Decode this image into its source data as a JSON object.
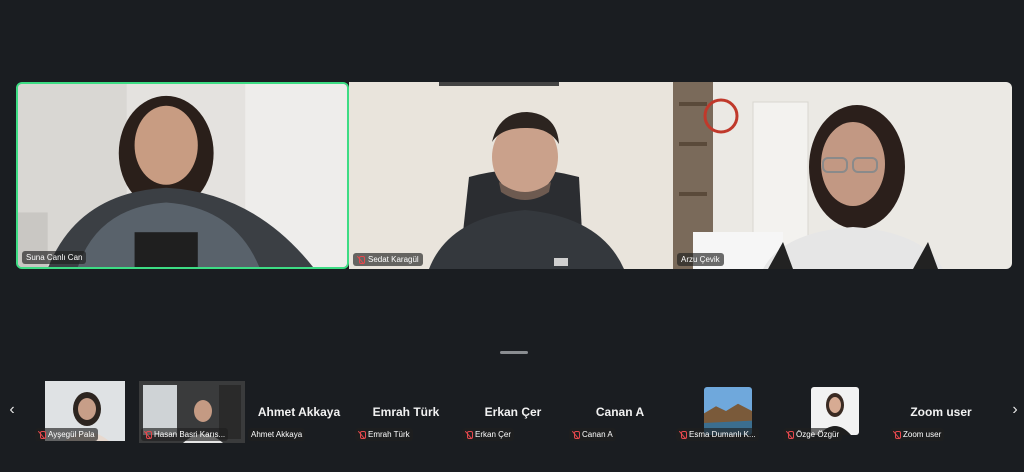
{
  "main_tiles": [
    {
      "name": "Suna Canlı Can"
    },
    {
      "name": "Sedat Karagül"
    },
    {
      "name": "Arzu Çevik"
    }
  ],
  "thumbnails": [
    {
      "name": "Ayşegül Pala",
      "big": ""
    },
    {
      "name": "Hasan Basri Karıs...",
      "big": ""
    },
    {
      "name": "Ahmet Akkaya",
      "big": "Ahmet Akkaya"
    },
    {
      "name": "Emrah Türk",
      "big": "Emrah Türk"
    },
    {
      "name": "Erkan Çer",
      "big": "Erkan Çer"
    },
    {
      "name": "Canan A",
      "big": "Canan A"
    },
    {
      "name": "Esma Dumanlı K...",
      "big": ""
    },
    {
      "name": "Özge Özgür",
      "big": ""
    },
    {
      "name": "Zoom user",
      "big": "Zoom user"
    }
  ],
  "icons": {
    "prev": "chevron-left-icon",
    "next": "chevron-right-icon",
    "mic": "mic-off-icon"
  },
  "colors": {
    "active_speaker_border": "#3ddc84",
    "background": "#1a1d21",
    "muted": "#e5484d"
  }
}
